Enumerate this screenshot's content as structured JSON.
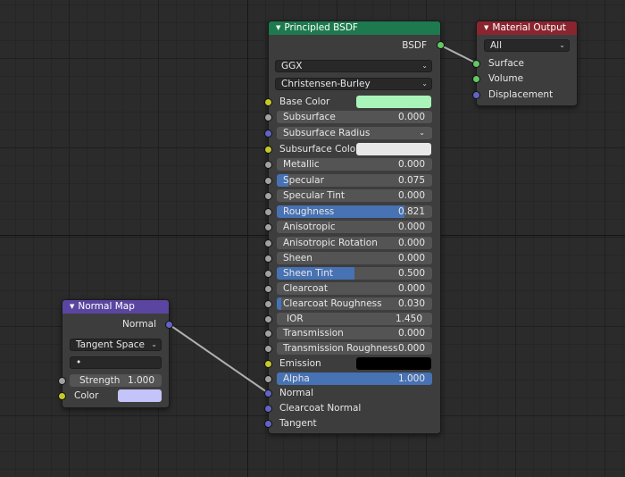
{
  "colors": {
    "socket_grey": "#a1a1a1",
    "socket_yellow": "#c7c729",
    "socket_purple": "#6363c7",
    "socket_green": "#63c763",
    "slider_fill": "#4772b3",
    "shader_header": "#1d7a4e",
    "output_header": "#8a2530",
    "vector_header": "#5a46a0"
  },
  "principled": {
    "title": "Principled BSDF",
    "output_label": "BSDF",
    "distribution": "GGX",
    "subsurface_method": "Christensen-Burley",
    "base_color_label": "Base Color",
    "base_color_value": "#a9f4b9",
    "subsurface_label": "Subsurface",
    "subsurface_value": "0.000",
    "subsurface_radius_label": "Subsurface Radius",
    "subsurface_color_label": "Subsurface Colo",
    "subsurface_color_value": "#e8e8e8",
    "metallic_label": "Metallic",
    "metallic_value": "0.000",
    "specular_label": "Specular",
    "specular_value": "0.075",
    "specular_tint_label": "Specular Tint",
    "specular_tint_value": "0.000",
    "roughness_label": "Roughness",
    "roughness_value": "0.821",
    "anisotropic_label": "Anisotropic",
    "anisotropic_value": "0.000",
    "anisotropic_rotation_label": "Anisotropic Rotation",
    "anisotropic_rotation_value": "0.000",
    "sheen_label": "Sheen",
    "sheen_value": "0.000",
    "sheen_tint_label": "Sheen Tint",
    "sheen_tint_value": "0.500",
    "clearcoat_label": "Clearcoat",
    "clearcoat_value": "0.000",
    "clearcoat_roughness_label": "Clearcoat Roughness",
    "clearcoat_roughness_value": "0.030",
    "ior_label": "IOR",
    "ior_value": "1.450",
    "transmission_label": "Transmission",
    "transmission_value": "0.000",
    "transmission_roughness_label": "Transmission Roughness",
    "transmission_roughness_value": "0.000",
    "emission_label": "Emission",
    "emission_value": "#000000",
    "alpha_label": "Alpha",
    "alpha_value": "1.000",
    "normal_label": "Normal",
    "clearcoat_normal_label": "Clearcoat Normal",
    "tangent_label": "Tangent"
  },
  "material_output": {
    "title": "Material Output",
    "target": "All",
    "surface_label": "Surface",
    "volume_label": "Volume",
    "displacement_label": "Displacement"
  },
  "normal_map": {
    "title": "Normal Map",
    "output_label": "Normal",
    "space": "Tangent Space",
    "uv_map": "•",
    "strength_label": "Strength",
    "strength_value": "1.000",
    "color_label": "Color",
    "color_value": "#c4c4fb"
  }
}
